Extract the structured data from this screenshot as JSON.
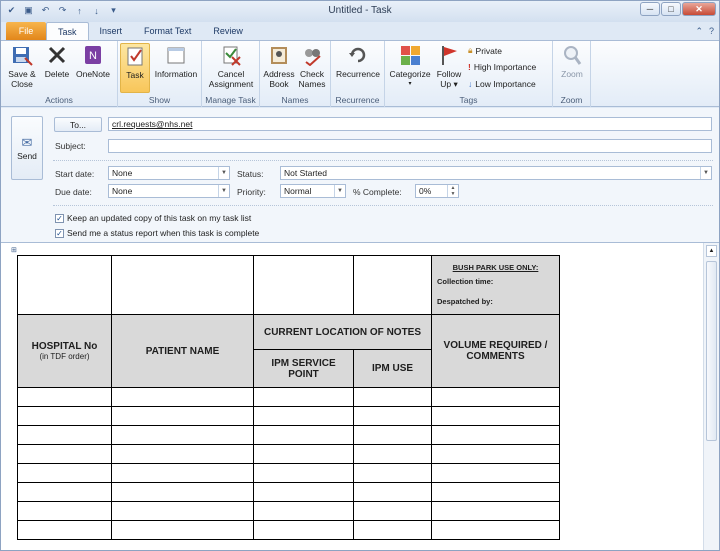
{
  "window": {
    "title": "Untitled  -  Task"
  },
  "tabs": [
    "File",
    "Task",
    "Insert",
    "Format Text",
    "Review"
  ],
  "ribbon": {
    "groups": [
      {
        "label": "Actions",
        "buttons": [
          "Save &\nClose",
          "Delete",
          "OneNote"
        ]
      },
      {
        "label": "Show",
        "buttons": [
          "Task",
          "Information"
        ]
      },
      {
        "label": "Manage Task",
        "buttons": [
          "Cancel\nAssignment"
        ]
      },
      {
        "label": "Names",
        "buttons": [
          "Address\nBook",
          "Check\nNames"
        ]
      },
      {
        "label": "Recurrence",
        "buttons": [
          "Recurrence"
        ]
      },
      {
        "label": "Tags",
        "buttons": [
          "Categorize",
          "Follow\nUp"
        ],
        "small": [
          "Private",
          "High Importance",
          "Low Importance"
        ]
      },
      {
        "label": "Zoom",
        "buttons": [
          "Zoom"
        ]
      }
    ]
  },
  "form": {
    "send": "Send",
    "to_button": "To...",
    "to_value": "crl.requests@nhs.net",
    "subject_label": "Subject:",
    "subject_value": "",
    "start_date_label": "Start date:",
    "start_date_value": "None",
    "due_date_label": "Due date:",
    "due_date_value": "None",
    "status_label": "Status:",
    "status_value": "Not Started",
    "priority_label": "Priority:",
    "priority_value": "Normal",
    "complete_label": "% Complete:",
    "complete_value": "0%",
    "check1": "Keep an updated copy of this task on my task list",
    "check2": "Send me a status report when this task is complete"
  },
  "document": {
    "bush_park_title": "BUSH PARK USE ONLY:",
    "collection": "Collection time:",
    "despatched": "Despatched by:",
    "col_hospital": "HOSPITAL No",
    "col_hospital_sub": "(in TDF order)",
    "col_patient": "PATIENT NAME",
    "col_location": "CURRENT LOCATION OF NOTES",
    "col_ipm_sp": "IPM SERVICE POINT",
    "col_ipm_use": "IPM USE",
    "col_volume": "VOLUME REQUIRED / COMMENTS"
  }
}
